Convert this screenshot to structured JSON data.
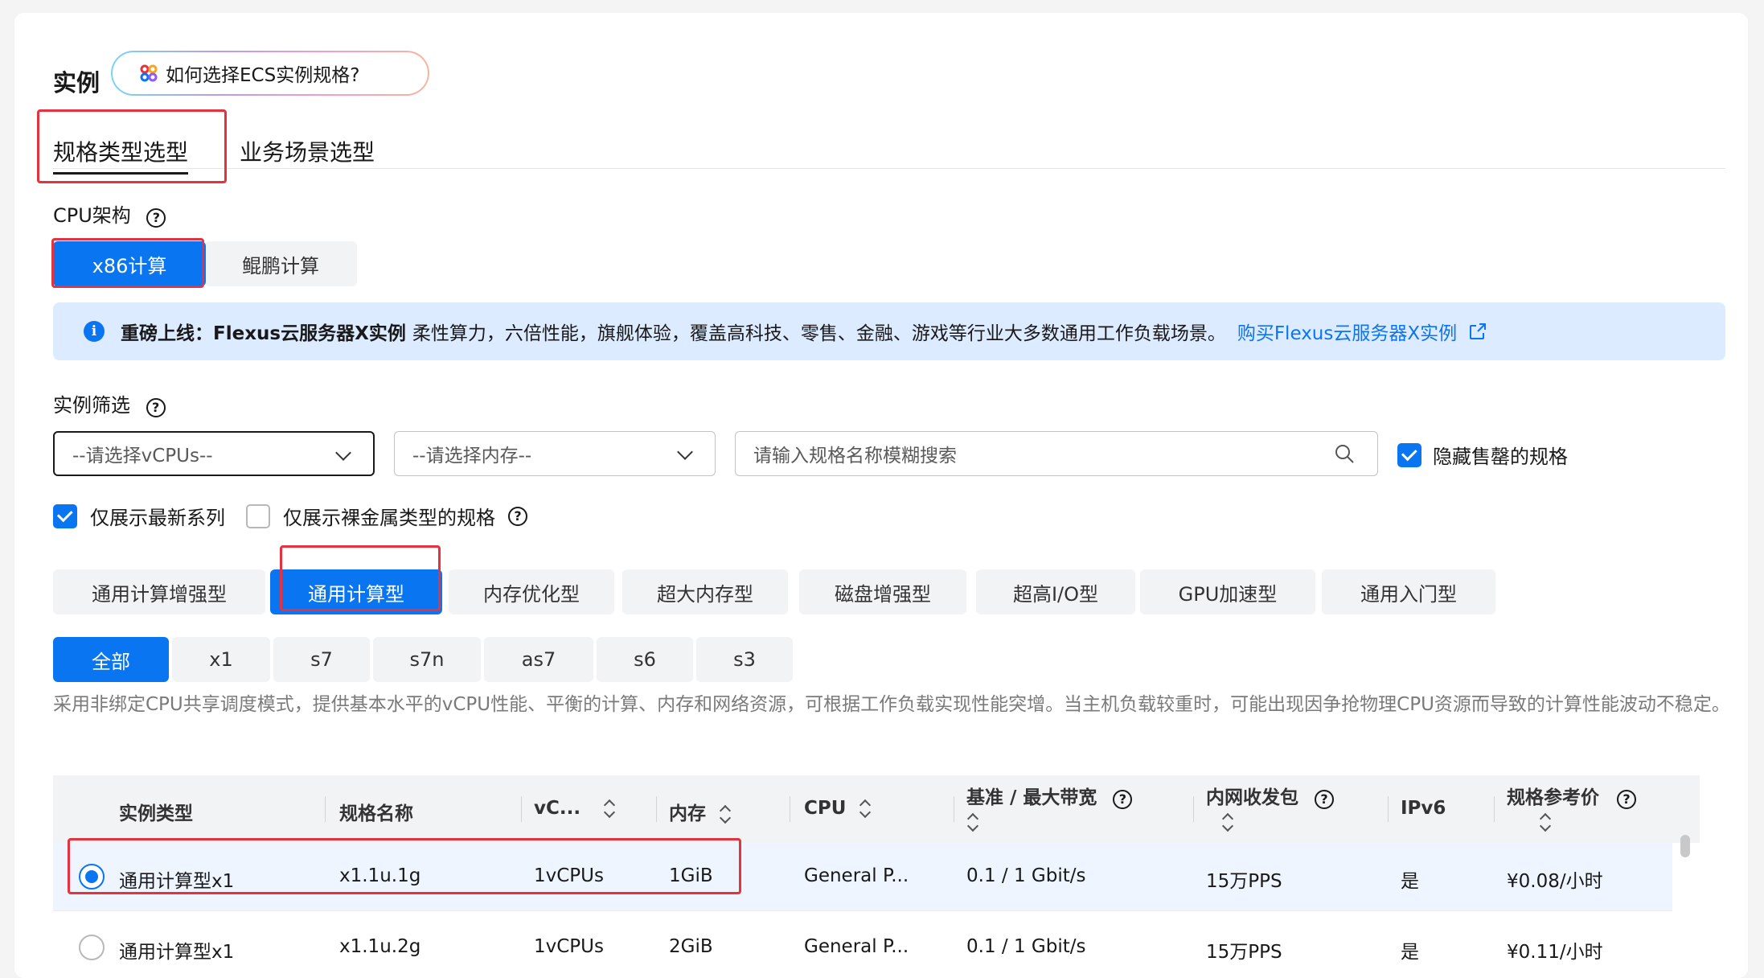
{
  "section": {
    "title": "实例",
    "ai_helper": "如何选择ECS实例规格?"
  },
  "tabs": [
    {
      "label": "规格类型选型",
      "active": true
    },
    {
      "label": "业务场景选型",
      "active": false
    }
  ],
  "cpu_arch": {
    "label": "CPU架构",
    "options": [
      "x86计算",
      "鲲鹏计算"
    ],
    "selected": "x86计算"
  },
  "banner": {
    "bold": "重磅上线：Flexus云服务器X实例",
    "text": "柔性算力，六倍性能，旗舰体验，覆盖高科技、零售、金融、游戏等行业大多数通用工作负载场景。",
    "link": "购买Flexus云服务器X实例"
  },
  "filter": {
    "label": "实例筛选",
    "vcpu_placeholder": "--请选择vCPUs--",
    "memory_placeholder": "--请选择内存--",
    "search_placeholder": "请输入规格名称模糊搜索",
    "hide_sold_out": {
      "label": "隐藏售罄的规格",
      "checked": true
    },
    "latest_series": {
      "label": "仅展示最新系列",
      "checked": true
    },
    "bare_metal": {
      "label": "仅展示裸金属类型的规格",
      "checked": false
    }
  },
  "categories": [
    "通用计算增强型",
    "通用计算型",
    "内存优化型",
    "超大内存型",
    "磁盘增强型",
    "超高I/O型",
    "GPU加速型",
    "通用入门型"
  ],
  "selected_category": "通用计算型",
  "subcategories": [
    "全部",
    "x1",
    "s7",
    "s7n",
    "as7",
    "s6",
    "s3"
  ],
  "selected_subcategory": "全部",
  "description": "采用非绑定CPU共享调度模式，提供基本水平的vCPU性能、平衡的计算、内存和网络资源，可根据工作负载实现性能突增。当主机负载较重时，可能出现因争抢物理CPU资源而导致的计算性能波动不稳定。",
  "table": {
    "headers": {
      "type": "实例类型",
      "name": "规格名称",
      "vcpu": "vC...",
      "memory": "内存",
      "cpu": "CPU",
      "bandwidth": "基准 / 最大带宽",
      "pps": "内网收发包",
      "ipv6": "IPv6",
      "price": "规格参考价"
    },
    "rows": [
      {
        "type": "通用计算型x1",
        "name": "x1.1u.1g",
        "vcpu": "1vCPUs",
        "memory": "1GiB",
        "cpu": "General P...",
        "bandwidth": "0.1 / 1 Gbit/s",
        "pps": "15万PPS",
        "ipv6": "是",
        "price": "¥0.08/小时",
        "selected": true
      },
      {
        "type": "通用计算型x1",
        "name": "x1.1u.2g",
        "vcpu": "1vCPUs",
        "memory": "2GiB",
        "cpu": "General P...",
        "bandwidth": "0.1 / 1 Gbit/s",
        "pps": "15万PPS",
        "ipv6": "是",
        "price": "¥0.11/小时",
        "selected": false
      }
    ]
  },
  "colors": {
    "accent": "#0a75f0",
    "highlight_border": "#e5323e",
    "banner_bg": "#dcebff"
  }
}
